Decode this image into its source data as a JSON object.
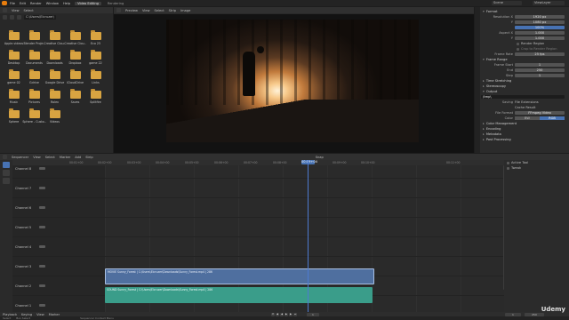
{
  "topbar": {
    "menus": [
      "File",
      "Edit",
      "Render",
      "Window",
      "Help"
    ],
    "workspaces": [
      "Video Editing",
      "Rendering"
    ],
    "active_workspace": "Video Editing",
    "scene": "Scene",
    "view_layer": "ViewLayer"
  },
  "filebrowser": {
    "header_menus": [
      "View",
      "Select"
    ],
    "path": "C:\\Users\\Elcruzer\\",
    "folders": [
      "Apple.videos",
      "Blender Proje..",
      "Creative Clou..",
      "Creative Clou..",
      "Eco 25",
      "Desktop",
      "Documents",
      "Downloads",
      "Dropbox",
      "game 22",
      "game 02",
      "Gdrive",
      "Google Drive",
      "iCloudDrive",
      "Links",
      "Music",
      "Pictures",
      "Rolex",
      "Saves",
      "Splitfire",
      "Sphere",
      "Sphere - Custo..",
      "Videos"
    ]
  },
  "preview": {
    "header_menus": [
      "Preview",
      "View",
      "Select",
      "Strip",
      "Image"
    ],
    "view_mode": "Preview"
  },
  "properties": {
    "sections": {
      "format": "Format",
      "frame_range": "Frame Range",
      "time_stretching": "Time Stretching",
      "stereoscopy": "Stereoscopy",
      "output": "Output",
      "color_management": "Color Management",
      "encoding": "Encoding",
      "metadata": "Metadata",
      "post_processing": "Post Processing"
    },
    "fields": {
      "resolution_x_label": "Resolution X",
      "resolution_x": "1920 px",
      "resolution_y_label": "Y",
      "resolution_y": "1080 px",
      "percent": "100%",
      "aspect_x_label": "Aspect X",
      "aspect_x": "1.000",
      "aspect_y_label": "Y",
      "aspect_y": "1.000",
      "render_region": "Render Region",
      "crop_region": "Crop to Render Region",
      "frame_rate_label": "Frame Rate",
      "frame_rate": "25 fps",
      "frame_start_label": "Frame Start",
      "frame_start": "1",
      "frame_end_label": "End",
      "frame_end": "250",
      "frame_step_label": "Step",
      "frame_step": "1",
      "output_path": "/tmp\\",
      "saving_label": "Saving",
      "file_extensions": "File Extensions",
      "cache_result": "Cache Result",
      "file_format_label": "File Format",
      "file_format": "FFmpeg Video",
      "color_label": "Color",
      "color_bw": "BW",
      "color_rgb": "RGB"
    }
  },
  "sequencer": {
    "header_menus": [
      "Sequencer",
      "View",
      "Select",
      "Marker",
      "Add",
      "Strip"
    ],
    "snap_label": "Snap",
    "ruler_ticks": [
      "00:01+00",
      "00:02+00",
      "00:03+00",
      "00:04+00",
      "00:05+00",
      "00:06+00",
      "00:07+00",
      "00:08+00",
      "00:09+00",
      "00:10+00",
      "00:11+00"
    ],
    "current_time": "00:09+04",
    "channels": [
      "Channel 8",
      "Channel 7",
      "Channel 6",
      "Channel 5",
      "Channel 4",
      "Channel 3",
      "Channel 2",
      "Channel 1"
    ],
    "strips": {
      "movie": "MOVIE Sunny_Forest | C:\\Users\\Elcruzer\\Downloads\\Sunny_Forest.mp4 | 286",
      "sound": "SOUND Sunny_Forest | C:\\Users\\Elcruzer\\Downloads\\Sunny_Forest.mp4 | 286"
    },
    "side_panel": [
      "Active Tool",
      "Tweak"
    ]
  },
  "playbar": {
    "menus": [
      "Playback",
      "Keying",
      "View",
      "Marker"
    ],
    "current_frame": "1",
    "start_label": "Start",
    "start": "1",
    "end_label": "End",
    "end": "250"
  },
  "statusbar": {
    "items": [
      "Select",
      "Box Select",
      "Sequencer Context Menu"
    ]
  },
  "watermark": "Udemy",
  "colors": {
    "accent": "#4772b3",
    "movie_strip": "#4f6f9f",
    "sound_strip": "#3a9d8a",
    "folder": "#d9a441"
  }
}
